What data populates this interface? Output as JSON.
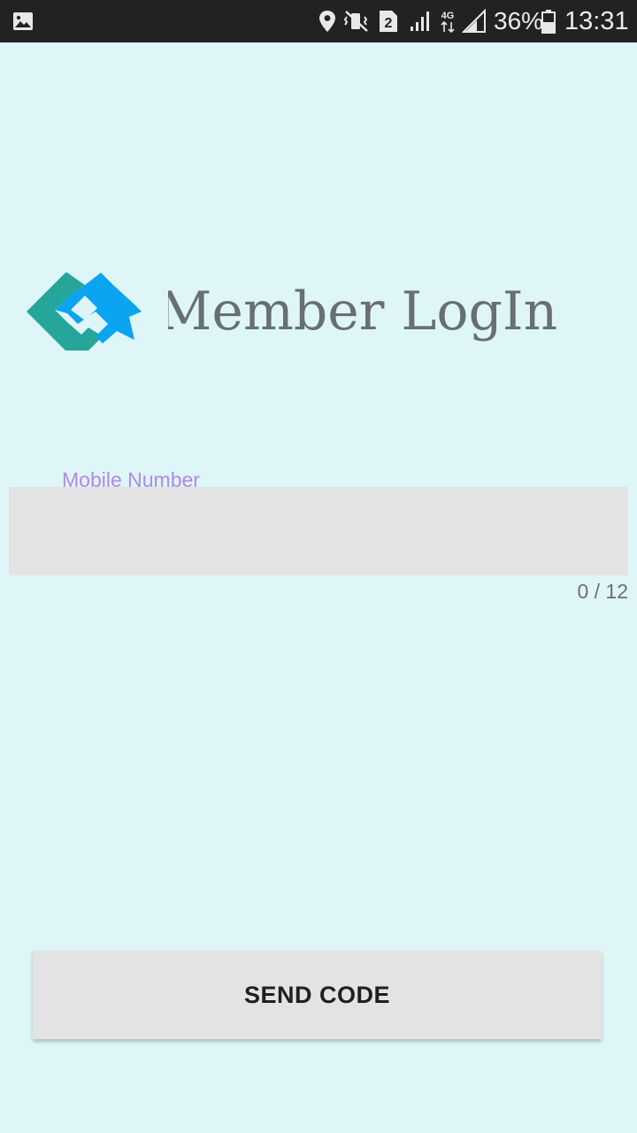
{
  "status_bar": {
    "battery_percent": "36%",
    "time": "13:31",
    "sim_slot": "2",
    "network_type": "4G",
    "icons": [
      "gallery-icon",
      "location-icon",
      "vibrate-mute-icon",
      "sim-2-icon",
      "signal-icon",
      "network-4g-icon",
      "signal-icon",
      "battery-icon"
    ]
  },
  "header": {
    "title": "Member LogIn",
    "logo_colors": {
      "teal": "#26a69a",
      "blue": "#0aa4f0"
    }
  },
  "form": {
    "mobile_label": "Mobile Number",
    "mobile_value": "",
    "counter": "0 / 12",
    "label_color": "#b08ae6"
  },
  "actions": {
    "send_code_label": "SEND CODE"
  }
}
